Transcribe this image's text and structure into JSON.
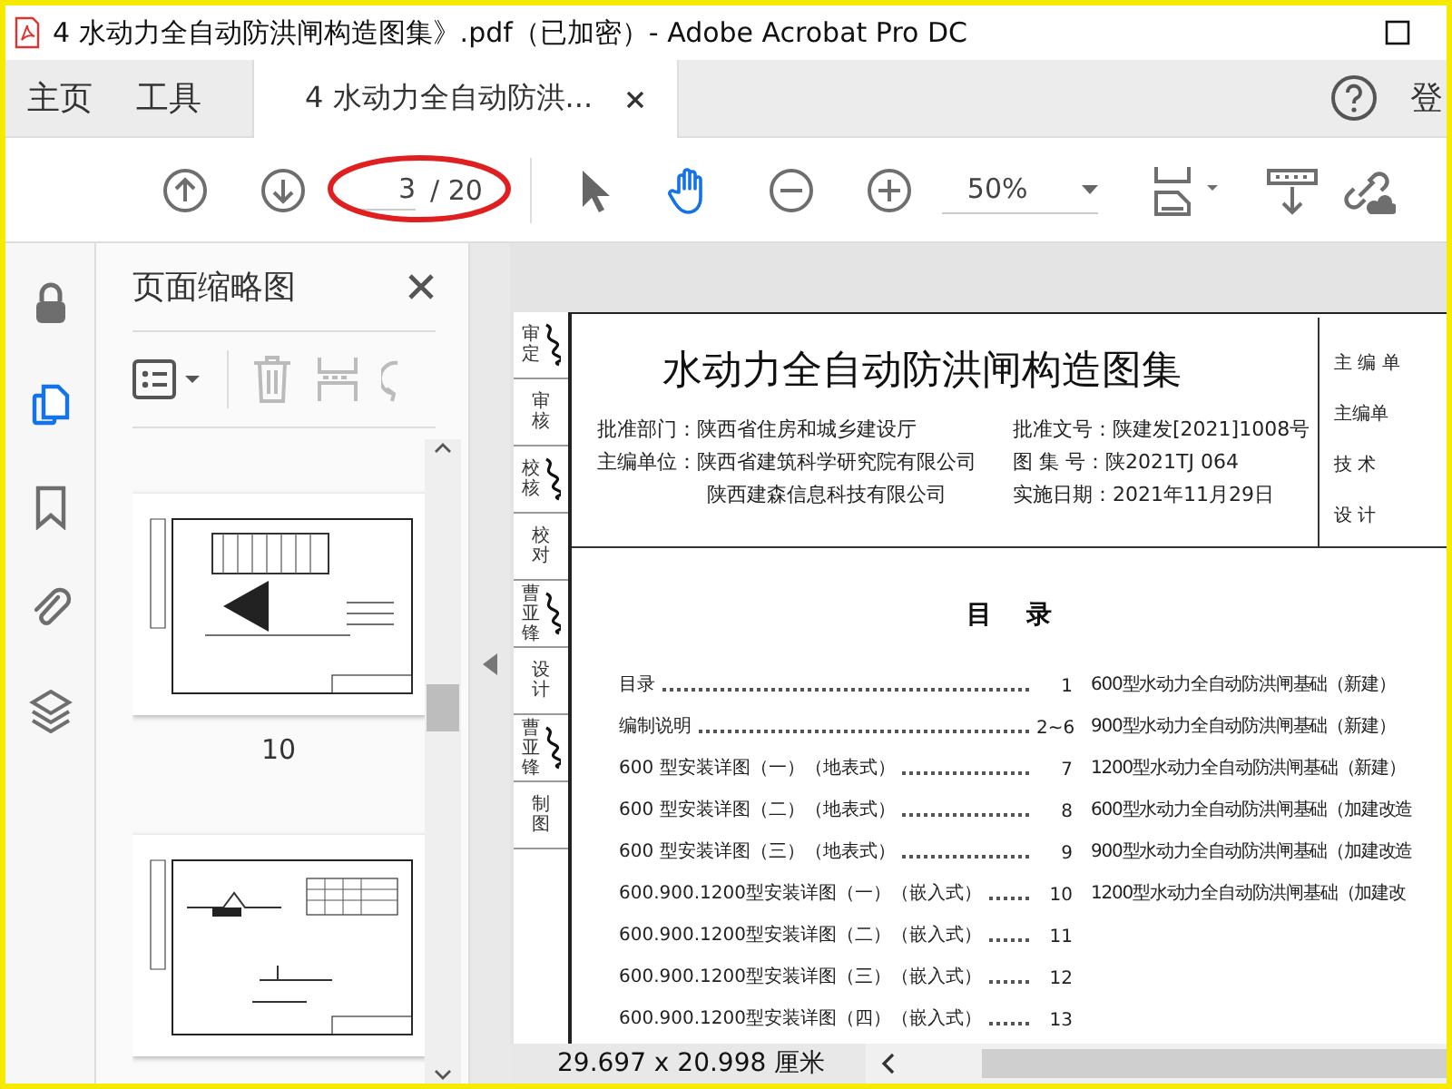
{
  "window": {
    "title": "4 水动力全自动防洪闸构造图集》.pdf（已加密）- Adobe Acrobat Pro DC"
  },
  "nav_tabs": [
    {
      "label": "主页",
      "selected": false
    },
    {
      "label": "工具",
      "selected": false
    },
    {
      "label": "4 水动力全自动防洪...",
      "selected": true,
      "closable": true
    }
  ],
  "sign_in": "登",
  "toolbar": {
    "page": "3",
    "page_total": "/ 20",
    "zoom": "50%",
    "hand_tool_selected": true
  },
  "side_rail": [
    {
      "kind": "lock",
      "selected": false
    },
    {
      "kind": "pages",
      "selected": true
    },
    {
      "kind": "bookmark",
      "selected": false
    },
    {
      "kind": "attachment",
      "selected": false
    },
    {
      "kind": "layers",
      "selected": false
    }
  ],
  "panel": {
    "title": "页面缩略图",
    "thumbnails": [
      {
        "kind": "plan",
        "label": "10"
      },
      {
        "kind": "section"
      }
    ]
  },
  "document": {
    "strip": [
      {
        "label": "审定",
        "signed": true
      },
      {
        "label": "审核",
        "signed": false
      },
      {
        "label": "校核",
        "signed": true
      },
      {
        "label": "校对",
        "signed": false
      },
      {
        "label": "曹亚锋",
        "signed": true
      },
      {
        "label": "设计",
        "signed": false
      },
      {
        "label": "曹亚锋",
        "signed": true
      },
      {
        "label": "制图",
        "signed": false
      }
    ],
    "title": "水动力全自动防洪闸构造图集",
    "info_left": [
      {
        "label": "批准部门：",
        "value": "陕西省住房和城乡建设厅"
      },
      {
        "label": "主编单位：",
        "value": "陕西省建筑科学研究院有限公司"
      },
      {
        "value": "陕西建森信息科技有限公司"
      }
    ],
    "info_right": [
      {
        "label": "批准文号：",
        "value": "陕建发[2021]1008号"
      },
      {
        "label": "图 集 号：",
        "value": "陕2021TJ 064"
      },
      {
        "label": "实施日期：",
        "value": "2021年11月29日"
      }
    ],
    "info_side": [
      "主 编 单",
      "主编单",
      "技  术",
      "设  计"
    ],
    "toc_title": "目    录",
    "toc_left": [
      {
        "text": "目录",
        "page": "1"
      },
      {
        "text": "编制说明",
        "page": "2~6"
      },
      {
        "text": "600 型安装详图（一）（地表式）",
        "page": "7"
      },
      {
        "text": "600 型安装详图（二）（地表式）",
        "page": "8"
      },
      {
        "text": "600 型安装详图（三）（地表式）",
        "page": "9"
      },
      {
        "text": "600.900.1200型安装详图（一）（嵌入式）",
        "page": "10"
      },
      {
        "text": "600.900.1200型安装详图（二）（嵌入式）",
        "page": "11"
      },
      {
        "text": "600.900.1200型安装详图（三）（嵌入式）",
        "page": "12"
      },
      {
        "text": "600.900.1200型安装详图（四）（嵌入式）",
        "page": "13"
      }
    ],
    "toc_right": [
      "600型水动力全自动防洪闸基础（新建）",
      "900型水动力全自动防洪闸基础（新建）",
      "1200型水动力全自动防洪闸基础（新建）",
      "600型水动力全自动防洪闸基础（加建改造",
      "900型水动力全自动防洪闸基础（加建改造",
      "1200型水动力全自动防洪闸基础（加建改"
    ]
  },
  "status_bar": {
    "page_size": "29.697 x 20.998 厘米"
  }
}
